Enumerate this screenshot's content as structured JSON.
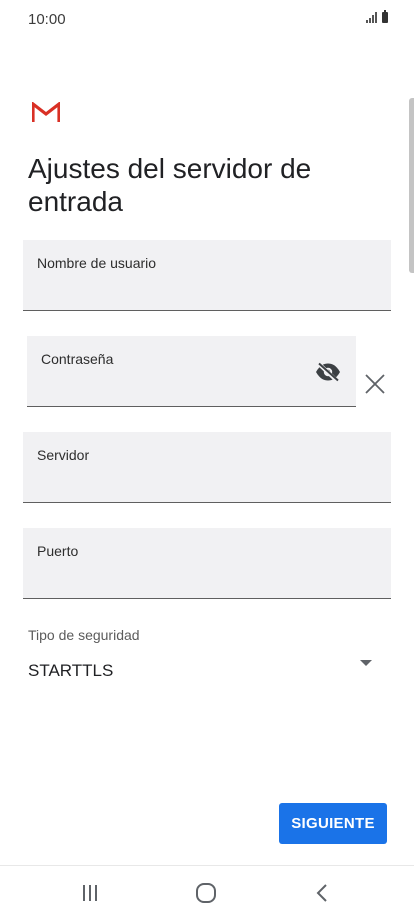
{
  "status_bar": {
    "time": "10:00",
    "icons": [
      "signal-icon",
      "battery-icon"
    ]
  },
  "header": {
    "logo": "gmail-logo",
    "title": "Ajustes del servidor de entrada"
  },
  "form": {
    "username": {
      "label": "Nombre de usuario",
      "value": ""
    },
    "password": {
      "label": "Contraseña",
      "value": "",
      "toggle_icon": "visibility-off-icon",
      "clear_icon": "close-icon"
    },
    "server": {
      "label": "Servidor",
      "value": ""
    },
    "port": {
      "label": "Puerto",
      "value": ""
    },
    "security": {
      "label": "Tipo de seguridad",
      "value": "STARTTLS",
      "icon": "dropdown-arrow-icon"
    }
  },
  "actions": {
    "next_label": "SIGUIENTE"
  },
  "navigation": {
    "icons": [
      "recents-icon",
      "home-icon",
      "back-icon"
    ]
  },
  "colors": {
    "accent": "#1a73e8",
    "field_background": "#f1f1f3",
    "gmail_red": "#d93025"
  }
}
